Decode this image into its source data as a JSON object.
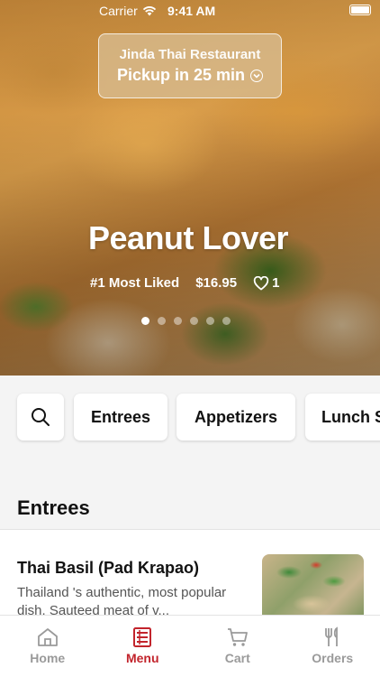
{
  "status_bar": {
    "carrier": "Carrier",
    "time": "9:41 AM"
  },
  "pickup": {
    "restaurant": "Jinda Thai Restaurant",
    "time_text": "Pickup in 25 min"
  },
  "hero": {
    "title": "Peanut Lover",
    "badge": "#1 Most Liked",
    "price": "$16.95",
    "likes": "1",
    "carousel": {
      "count": 6,
      "active_index": 0
    }
  },
  "categories": [
    "Entrees",
    "Appetizers",
    "Lunch S"
  ],
  "section": {
    "title": "Entrees"
  },
  "menu_items": [
    {
      "name": "Thai Basil (Pad Krapao)",
      "description": "Thailand 's authentic, most popular dish. Sauteed meat of v..."
    }
  ],
  "tabs": [
    {
      "label": "Home",
      "icon": "home-icon",
      "active": false
    },
    {
      "label": "Menu",
      "icon": "menu-icon",
      "active": true
    },
    {
      "label": "Cart",
      "icon": "cart-icon",
      "active": false
    },
    {
      "label": "Orders",
      "icon": "utensils-icon",
      "active": false
    }
  ],
  "colors": {
    "accent": "#c2242c",
    "tab_inactive": "#9a9a9a"
  }
}
